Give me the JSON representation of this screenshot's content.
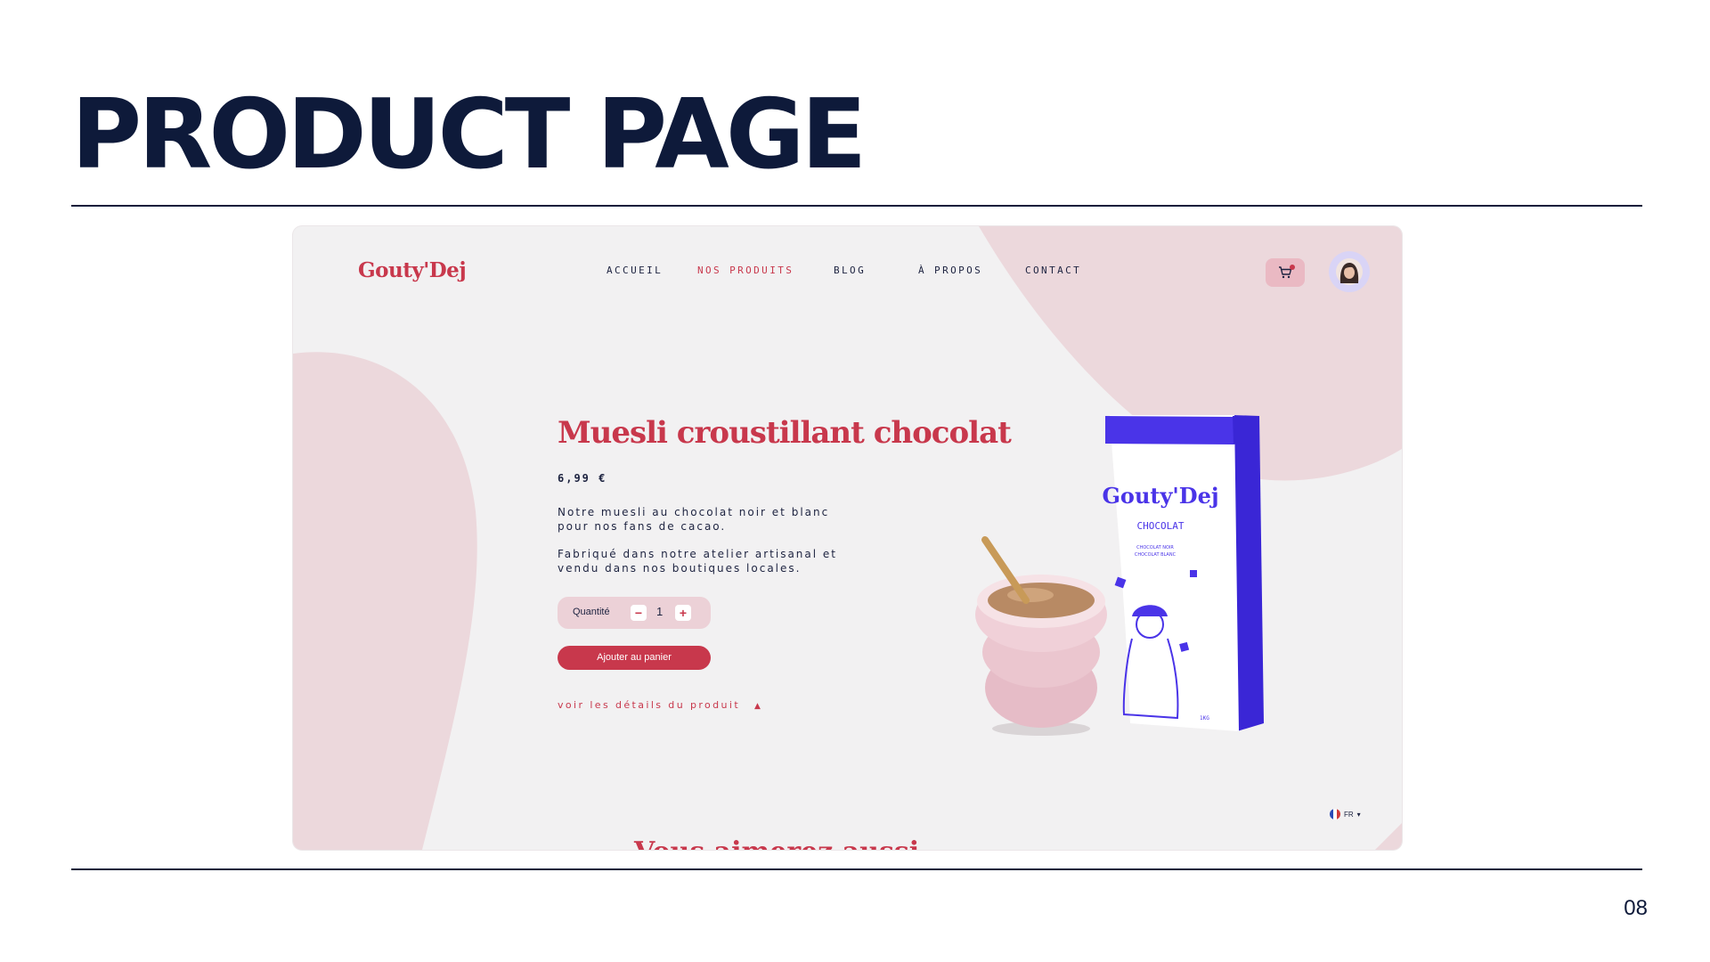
{
  "slide": {
    "title": "PRODUCT PAGE",
    "page_number": "08"
  },
  "site": {
    "logo": "Gouty'Dej",
    "nav": [
      {
        "label": "ACCUEIL",
        "active": false
      },
      {
        "label": "NOS PRODUITS",
        "active": true
      },
      {
        "label": "BLOG",
        "active": false
      },
      {
        "label": "À PROPOS",
        "active": false
      },
      {
        "label": "CONTACT",
        "active": false
      }
    ],
    "header_icons": [
      "cart-icon",
      "avatar"
    ],
    "product": {
      "title": "Muesli croustillant chocolat",
      "price": "6,99 €",
      "description_1": "Notre muesli au chocolat noir et blanc pour nos fans de cacao.",
      "description_2": "Fabriqué dans notre atelier artisanal et vendu dans nos boutiques locales.",
      "quantity_label": "Quantité",
      "quantity_value": "1",
      "minus_symbol": "−",
      "plus_symbol": "+",
      "add_to_cart": "Ajouter au panier",
      "details_link": "voir les détails du produit"
    },
    "packaging": {
      "brand": "Gouty'Dej",
      "flavor": "CHOCOLAT",
      "subtitle_1": "CHOCOLAT NOIR",
      "subtitle_2": "CHOCOLAT BLANC",
      "weight": "1KG"
    },
    "language": "FR",
    "section_teaser": "Vous aimerez aussi"
  },
  "colors": {
    "navy": "#0e1a3a",
    "brand_red": "#c8384c",
    "blob_pink": "#ecd8dc",
    "page_grey": "#f2f1f2",
    "bag_blue": "#4a34e8"
  }
}
